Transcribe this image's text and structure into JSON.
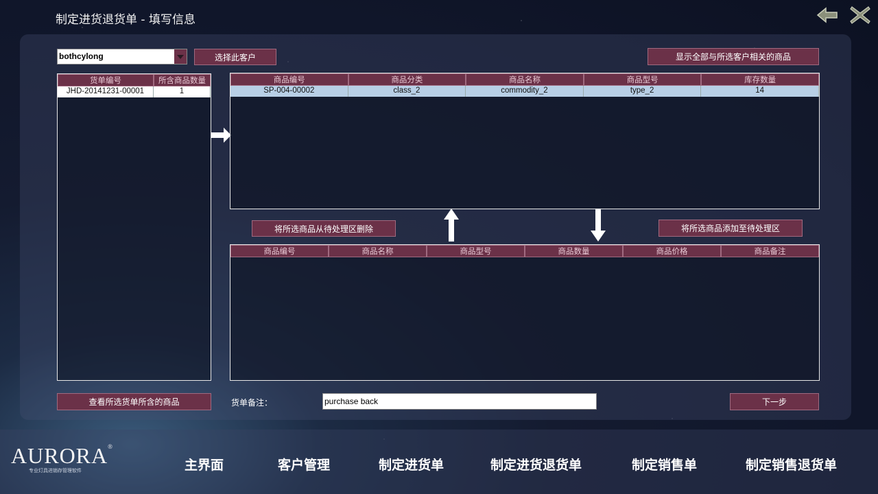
{
  "window": {
    "title": "制定进货退货单 - 填写信息"
  },
  "customer": {
    "selected": "bothcylong",
    "select_button": "选择此客户"
  },
  "show_all_button": "显示全部与所选客户相关的商品",
  "orders_table": {
    "columns": [
      "货单编号",
      "所含商品数量"
    ],
    "rows": [
      [
        "JHD-20141231-00001",
        "1"
      ]
    ]
  },
  "products_table": {
    "columns": [
      "商品编号",
      "商品分类",
      "商品名称",
      "商品型号",
      "库存数量"
    ],
    "rows": [
      [
        "SP-004-00002",
        "class_2",
        "commodity_2",
        "type_2",
        "14"
      ]
    ]
  },
  "remove_button": "将所选商品从待处理区删除",
  "add_button": "将所选商品添加至待处理区",
  "pending_table": {
    "columns": [
      "商品编号",
      "商品名称",
      "商品型号",
      "商品数量",
      "商品价格",
      "商品备注"
    ]
  },
  "view_goods_button": "查看所选货单所含的商品",
  "note": {
    "label": "货单备注：",
    "value": "purchase back"
  },
  "next_button": "下一步",
  "brand": {
    "logo_text": "AURORA",
    "reg_mark": "®",
    "tagline": "专业灯具进销存管理软件"
  },
  "nav": [
    "主界面",
    "客户管理",
    "制定进货单",
    "制定进货退货单",
    "制定销售单",
    "制定销售退货单"
  ],
  "colors": {
    "accent": "#6b3148",
    "selected_row": "#b8cfe6"
  }
}
